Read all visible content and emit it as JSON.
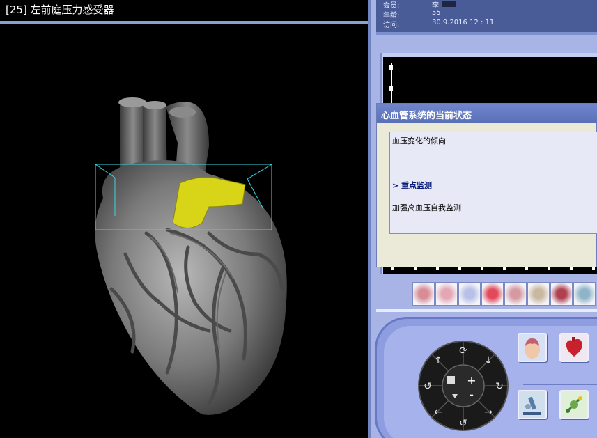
{
  "viewer": {
    "title": "[25] 左前庭压力感受器"
  },
  "patient": {
    "member_label": "会员:",
    "member_value": "李",
    "age_label": "年龄:",
    "age_value": "55",
    "visit_label": "访问:",
    "visit_value": "30.9.2016  12 : 11"
  },
  "dialog": {
    "title": "心血管系统的当前状态",
    "line1": "血压变化的倾向",
    "focus": "> 重点监测",
    "advice": "加强高血压自我监测"
  },
  "thumbnails": [
    {
      "icon": "lungs-icon",
      "color": "#d98c95"
    },
    {
      "icon": "digestive-icon",
      "color": "#e3a6b3"
    },
    {
      "icon": "cells-icon",
      "color": "#b8c0e8"
    },
    {
      "icon": "blood-cells-icon",
      "color": "#e04a5a"
    },
    {
      "icon": "kidney-icon",
      "color": "#d49aa0"
    },
    {
      "icon": "spine-icon",
      "color": "#c9b8a0"
    },
    {
      "icon": "circulatory-icon",
      "color": "#b04050"
    },
    {
      "icon": "skeleton-icon",
      "color": "#8fb4c8"
    }
  ],
  "controls": {
    "wheel_plus": "+",
    "wheel_minus": "-",
    "buttons": [
      "brain-icon",
      "heart-icon",
      "microscope-icon",
      "molecule-icon"
    ]
  },
  "colors": {
    "panel_bg": "#a8b4e6",
    "info_bg": "#4a5c98",
    "highlight_box": "#37d6e0",
    "selected_tissue": "#d8d418"
  }
}
